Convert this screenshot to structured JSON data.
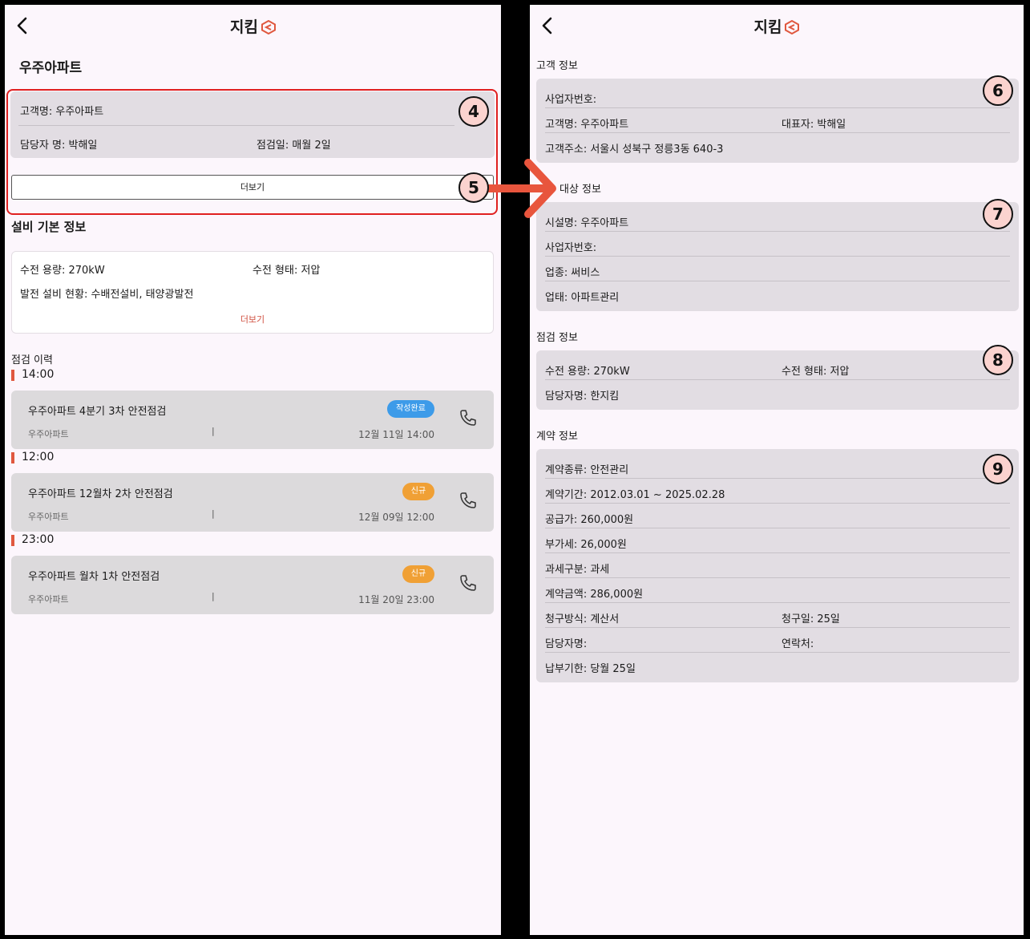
{
  "app": {
    "title": "지킴"
  },
  "left": {
    "page_title": "우주아파트",
    "customer": {
      "name_text": "고객명: 우주아파트",
      "manager_text": "담당자 명: 박해일",
      "inspection_day_text": "점검일: 매월 2일",
      "more_label": "더보기"
    },
    "equipment": {
      "heading": "설비 기본 정보",
      "capacity_text": "수전 용량: 270kW",
      "type_text": "수전 형태: 저압",
      "status_text": "발전 설비 현황: 수배전설비, 태양광발전",
      "more_label": "더보기"
    },
    "history": {
      "heading": "점검 이력",
      "items": [
        {
          "time": "14:00",
          "title": "우주아파트 4분기 3차 안전점검",
          "subtitle": "우주아파트",
          "separator": "|",
          "date": "12월 11일 14:00",
          "badge": "작성완료"
        },
        {
          "time": "12:00",
          "title": "우주아파트 12월차 2차 안전점검",
          "subtitle": "우주아파트",
          "separator": "|",
          "date": "12월 09일 12:00",
          "badge": "신규"
        },
        {
          "time": "23:00",
          "title": "우주아파트 월차 1차 안전점검",
          "subtitle": "우주아파트",
          "separator": "|",
          "date": "11월 20일 23:00",
          "badge": "신규"
        }
      ]
    }
  },
  "right": {
    "customer_info": {
      "heading": "고객 정보",
      "business_no": "사업자번호:",
      "name": "고객명: 우주아파트",
      "representative": "대표자: 박해일",
      "address": "고객주소: 서울시 성북구 정릉3동 640-3"
    },
    "facility_info": {
      "heading": "대상 정보",
      "facility_name": "시설명: 우주아파트",
      "business_no": "사업자번호:",
      "industry": "업종: 써비스",
      "business_type": "업태: 아파트관리"
    },
    "inspection_info": {
      "heading": "점검 정보",
      "capacity": "수전 용량: 270kW",
      "type": "수전 형태: 저압",
      "manager": "담당자명: 한지킴"
    },
    "contract_info": {
      "heading": "계약 정보",
      "contract_type": "계약종류:  안전관리",
      "period": "계약기간: 2012.03.01 ~ 2025.02.28",
      "supply_price": "공급가:  260,000원",
      "vat": "부가세:  26,000원",
      "tax_class": "과세구분:  과세",
      "amount": "계약금액: 286,000원",
      "billing_method": "청구방식: 계산서",
      "billing_day": "청구일: 25일",
      "manager": "담당자명:",
      "contact": "연락처:",
      "payment_deadline": "납부기한: 당월 25일"
    }
  },
  "annotations": {
    "n4": "4",
    "n5": "5",
    "n6": "6",
    "n7": "7",
    "n8": "8",
    "n9": "9"
  },
  "colors": {
    "accent": "#e0583f",
    "badge_done": "#3d9be9",
    "badge_new": "#f0a035",
    "highlight": "#e02020"
  }
}
